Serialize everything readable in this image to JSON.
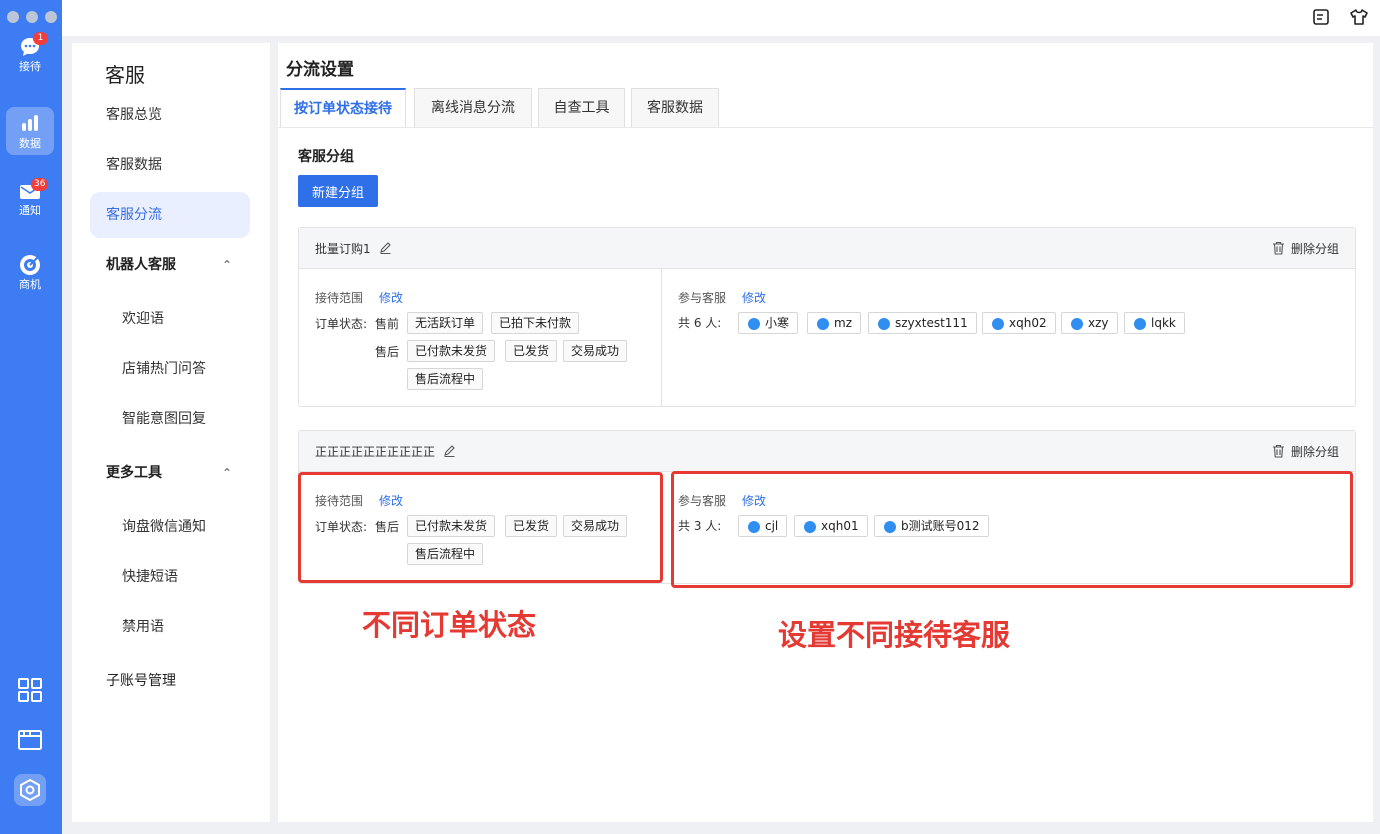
{
  "rail": {
    "items": [
      {
        "label": "接待",
        "badge": "1",
        "icon": "chat-bubble-icon"
      },
      {
        "label": "数据",
        "badge": "",
        "icon": "bar-chart-icon"
      },
      {
        "label": "通知",
        "badge": "36",
        "icon": "mail-icon"
      },
      {
        "label": "商机",
        "badge": "",
        "icon": "target-icon"
      }
    ],
    "tools": [
      "apps-grid-icon",
      "window-icon",
      "settings-hexagon-icon"
    ],
    "accent": "#3d7cf2"
  },
  "topbar": {
    "icons": [
      "notes-icon",
      "shirt-icon"
    ]
  },
  "nav": {
    "title": "客服",
    "items": [
      {
        "label": "客服总览"
      },
      {
        "label": "客服数据"
      },
      {
        "label": "客服分流"
      },
      {
        "label": "机器人客服",
        "caret": "⌃"
      },
      {
        "label": "欢迎语"
      },
      {
        "label": "店铺热门问答"
      },
      {
        "label": "智能意图回复"
      },
      {
        "label": "更多工具",
        "caret": "⌃"
      },
      {
        "label": "询盘微信通知"
      },
      {
        "label": "快捷短语"
      },
      {
        "label": "禁用语"
      },
      {
        "label": "子账号管理"
      }
    ]
  },
  "main": {
    "title": "分流设置",
    "tabs": [
      {
        "label": "按订单状态接待"
      },
      {
        "label": "离线消息分流"
      },
      {
        "label": "自查工具"
      },
      {
        "label": "客服数据"
      }
    ],
    "section_title": "客服分组",
    "new_group_button": "新建分组",
    "delete_label": "删除分组",
    "groups": [
      {
        "name": "批量订购1",
        "scope_label": "接待范围",
        "edit_label": "修改",
        "order_status_label": "订单状态:",
        "pre_label": "售前",
        "pre_tags": [
          "无活跃订单",
          "已拍下未付款"
        ],
        "post_label": "售后",
        "post_tags": [
          "已付款未发货",
          "已发货",
          "交易成功",
          "售后流程中"
        ],
        "agents_label": "参与客服",
        "agents_count": "共 6 人:",
        "agents": [
          "小寒",
          "mz",
          "szyxtest111",
          "xqh02",
          "xzy",
          "lqkk"
        ]
      },
      {
        "name": "正正正正正正正正正正",
        "scope_label": "接待范围",
        "edit_label": "修改",
        "order_status_label": "订单状态:",
        "post_label": "售后",
        "post_tags": [
          "已付款未发货",
          "已发货",
          "交易成功",
          "售后流程中"
        ],
        "agents_label": "参与客服",
        "agents_count": "共 3 人:",
        "agents": [
          "cjl",
          "xqh01",
          "b测试账号012"
        ]
      }
    ]
  },
  "annotations": {
    "left": "不同订单状态",
    "right": "设置不同接待客服",
    "color": "#e53a33"
  }
}
